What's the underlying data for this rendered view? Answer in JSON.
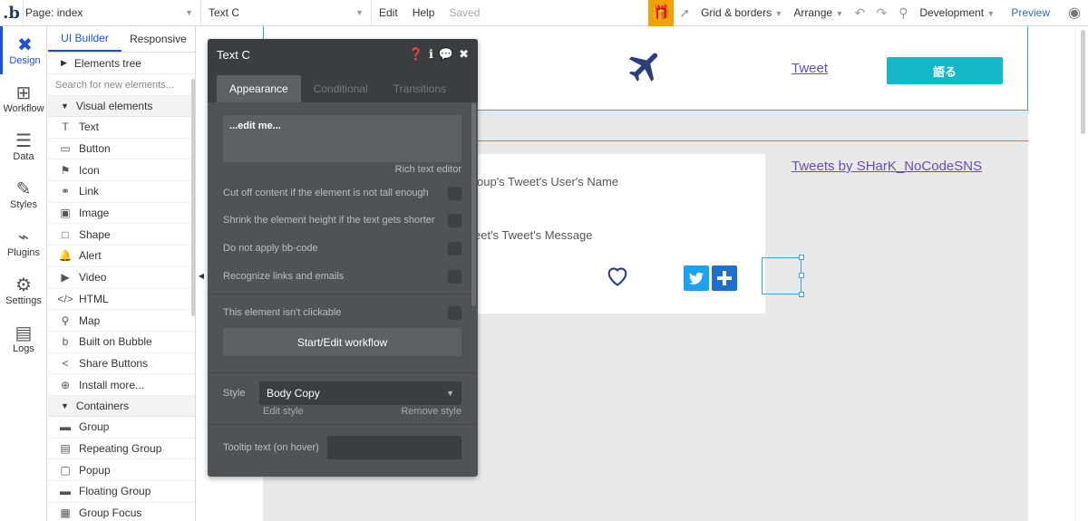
{
  "topbar": {
    "logo": ".b",
    "page_label": "Page: index",
    "element_label": "Text C",
    "menu": [
      "Edit",
      "Help"
    ],
    "saved": "Saved",
    "grid": "Grid & borders",
    "arrange": "Arrange",
    "env": "Development",
    "preview": "Preview"
  },
  "rail": [
    "Design",
    "Workflow",
    "Data",
    "Styles",
    "Plugins",
    "Settings",
    "Logs"
  ],
  "panel": {
    "tabs": [
      "UI Builder",
      "Responsive"
    ],
    "elements_tree": "Elements tree",
    "search_placeholder": "Search for new elements...",
    "visual_section": "Visual elements",
    "visual": [
      {
        "icon": "T",
        "label": "Text"
      },
      {
        "icon": "▭",
        "label": "Button"
      },
      {
        "icon": "⚑",
        "label": "Icon"
      },
      {
        "icon": "⚭",
        "label": "Link"
      },
      {
        "icon": "▣",
        "label": "Image"
      },
      {
        "icon": "□",
        "label": "Shape"
      },
      {
        "icon": "🔔",
        "label": "Alert"
      },
      {
        "icon": "▶",
        "label": "Video"
      },
      {
        "icon": "</>",
        "label": "HTML"
      },
      {
        "icon": "⚲",
        "label": "Map"
      },
      {
        "icon": "b",
        "label": "Built on Bubble"
      },
      {
        "icon": "<",
        "label": "Share Buttons"
      },
      {
        "icon": "⊕",
        "label": "Install more..."
      }
    ],
    "containers_section": "Containers",
    "containers": [
      {
        "icon": "▬",
        "label": "Group"
      },
      {
        "icon": "▤",
        "label": "Repeating Group"
      },
      {
        "icon": "▢",
        "label": "Popup"
      },
      {
        "icon": "▬",
        "label": "Floating Group"
      },
      {
        "icon": "▦",
        "label": "Group Focus"
      }
    ]
  },
  "editor": {
    "title": "Text C",
    "tabs": [
      "Appearance",
      "Conditional",
      "Transitions"
    ],
    "rte_value": "...edit me...",
    "rte_label": "Rich text editor",
    "options": [
      "Cut off content if the element is not tall enough",
      "Shrink the element height if the text gets shorter",
      "Do not apply bb-code",
      "Recognize links and emails",
      "This element isn't clickable"
    ],
    "workflow_button": "Start/Edit workflow",
    "style_label": "Style",
    "style_value": "Body Copy",
    "edit_style": "Edit style",
    "remove_style": "Remove style",
    "tooltip_label": "Tooltip text (on hover)"
  },
  "canvas": {
    "tweet_link": "Tweet",
    "talk_button": "語る",
    "feed_link": "Tweets by SHarK_NoCodeSNS",
    "user_name_text": "oup's Tweet's User's Name",
    "message_text": "eet's Tweet's Message"
  },
  "colors": {
    "accent": "#1f4fd8",
    "teal": "#14b8c8",
    "twitter": "#1da1f2",
    "plane": "#2b3d7a"
  }
}
